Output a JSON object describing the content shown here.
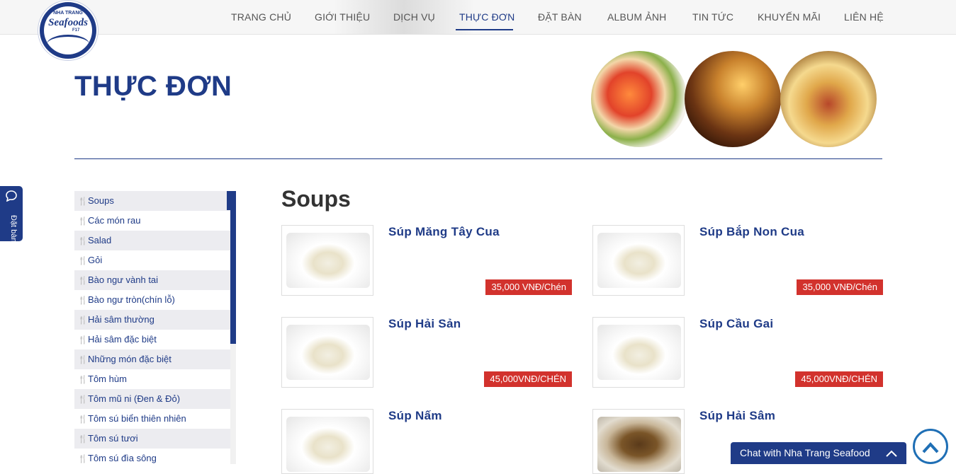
{
  "logo": {
    "top": "NHA TRANG",
    "word": "Seafoods",
    "sub": "F17"
  },
  "nav": [
    {
      "label": "TRANG CHỦ",
      "active": false
    },
    {
      "label": "GIỚI THIỆU",
      "active": false
    },
    {
      "label": "DỊCH VỤ",
      "active": false
    },
    {
      "label": "THỰC ĐƠN",
      "active": true
    },
    {
      "label": "ĐẶT BÀN",
      "active": false
    },
    {
      "label": "ALBUM ẢNH",
      "active": false
    },
    {
      "label": "TIN TỨC",
      "active": false
    },
    {
      "label": "KHUYẾN MÃI",
      "active": false
    },
    {
      "label": "LIÊN HỆ",
      "active": false
    }
  ],
  "page_title": "THỰC ĐƠN",
  "side_tab": {
    "label": "Đặt bàn",
    "icon": "chat-icon"
  },
  "menu": [
    "Soups",
    "Các món rau",
    "Salad",
    "Gỏi",
    "Bào ngư vành tai",
    "Bào ngư tròn(chín lỗ)",
    "Hải sâm thường",
    "Hải sâm đặc biệt",
    "Những món đặc biệt",
    "Tôm hùm",
    "Tôm mũ ni (Đen & Đỏ)",
    "Tôm sú biển thiên nhiên",
    "Tôm sú tươi",
    "Tôm sú đìa sông"
  ],
  "section_title": "Soups",
  "dishes": [
    {
      "name": "Súp Măng Tây Cua",
      "price": "35,000 VNĐ/Chén"
    },
    {
      "name": "Súp Bắp Non Cua",
      "price": "35,000 VNĐ/Chén"
    },
    {
      "name": "Súp Hải Sản",
      "price": "45,000VNĐ/CHÉN"
    },
    {
      "name": "Súp Cầu Gai",
      "price": "45,000VNĐ/CHÉN"
    },
    {
      "name": "Súp Nấm",
      "price": ""
    },
    {
      "name": "Súp Hải Sâm",
      "price": ""
    }
  ],
  "chat": {
    "label": "Chat with Nha Trang Seafood",
    "icon": "chevron-up-icon"
  },
  "back_to_top": {
    "icon": "arrow-up-icon"
  },
  "colors": {
    "brand": "#1f3b87",
    "price_badge": "#d2322d",
    "back_top": "#1f6fb5"
  }
}
